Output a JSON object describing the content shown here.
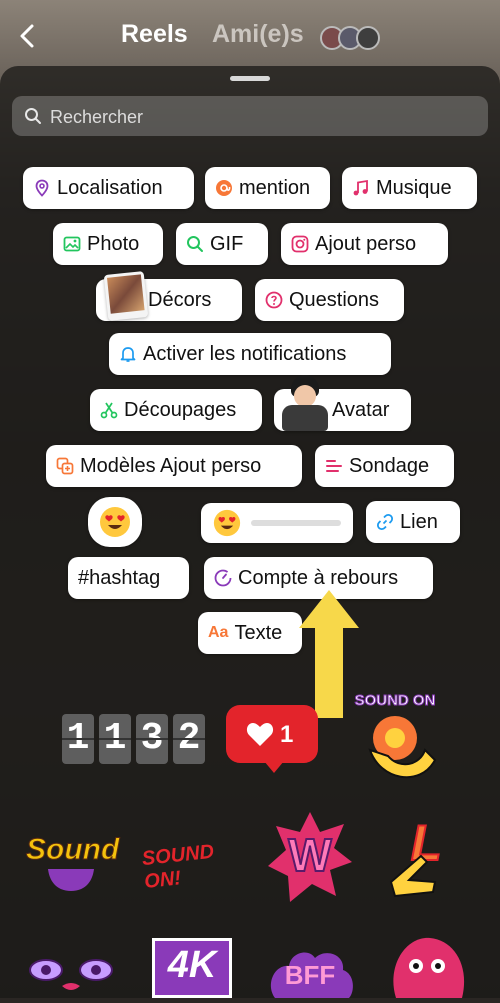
{
  "header": {
    "title": "Reels",
    "friends_label": "Ami(e)s",
    "back_icon": "chevron-left-icon"
  },
  "search": {
    "placeholder": "Rechercher"
  },
  "chips": {
    "localisation": "Localisation",
    "mention": "mention",
    "musique": "Musique",
    "photo": "Photo",
    "gif": "GIF",
    "ajout_perso": "Ajout perso",
    "decors": "Décors",
    "questions": "Questions",
    "notifications": "Activer les notifications",
    "decoupages": "Découpages",
    "avatar": "Avatar",
    "modeles": "Modèles Ajout perso",
    "sondage": "Sondage",
    "lien": "Lien",
    "hashtag": "#hashtag",
    "compte": "Compte à rebours",
    "texte": "Texte",
    "texte_prefix": "Aa"
  },
  "stickers": {
    "counter_digits": [
      "1",
      "1",
      "3",
      "2"
    ],
    "likes_count": "1",
    "sound_on_text": "SOUND ON",
    "sound_text": "Sound",
    "sound_on2_text": "SOUND ON!",
    "w_letter": "W",
    "l_letter": "L",
    "fourk_text": "4K",
    "bff_text": "BFF"
  },
  "colors": {
    "accent_purple": "#8a3ab9",
    "accent_pink": "#e1306c",
    "accent_green": "#22c55e",
    "accent_blue": "#1d9bf0",
    "accent_orange": "#f77737",
    "arrow_yellow": "#f7d84a"
  }
}
